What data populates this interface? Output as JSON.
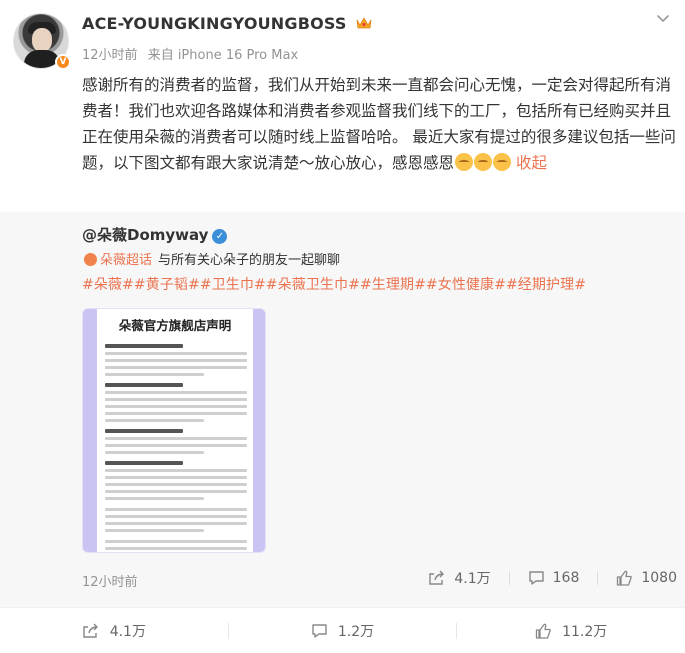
{
  "post": {
    "username": "ACE-YOUNGKINGYOUNGBOSS",
    "time": "12小时前",
    "source": "来自 iPhone 16 Pro Max",
    "text": "感谢所有的消费者的监督，我们从开始到未来一直都会问心无愧，一定会对得起所有消费者！我们也欢迎各路媒体和消费者参观监督我们线下的工厂，包括所有已经购买并且正在使用朵薇的消费者可以随时线上监督哈哈。 最近大家有提过的很多建议包括一些问题，以下图文都有跟大家说清楚～放心放心，感恩感恩",
    "collapse_label": "收起"
  },
  "repost": {
    "author": "@朵薇Domyway",
    "supertopic_label": "朵薇超话",
    "supertopic_desc": "与所有关心朵子的朋友一起聊聊",
    "hashtags": "#朵薇##黄子韬##卫生巾##朵薇卫生巾##生理期##女性健康##经期护理#",
    "doc_title": "朵薇官方旗舰店声明",
    "time": "12小时前",
    "reposts": "4.1万",
    "comments": "168",
    "likes": "1080"
  },
  "actions": {
    "reposts": "4.1万",
    "comments": "1.2万",
    "likes": "11.2万"
  },
  "colors": {
    "accent": "#eb7350",
    "verified": "#f78a1c",
    "blue_badge": "#3b8fd9"
  }
}
